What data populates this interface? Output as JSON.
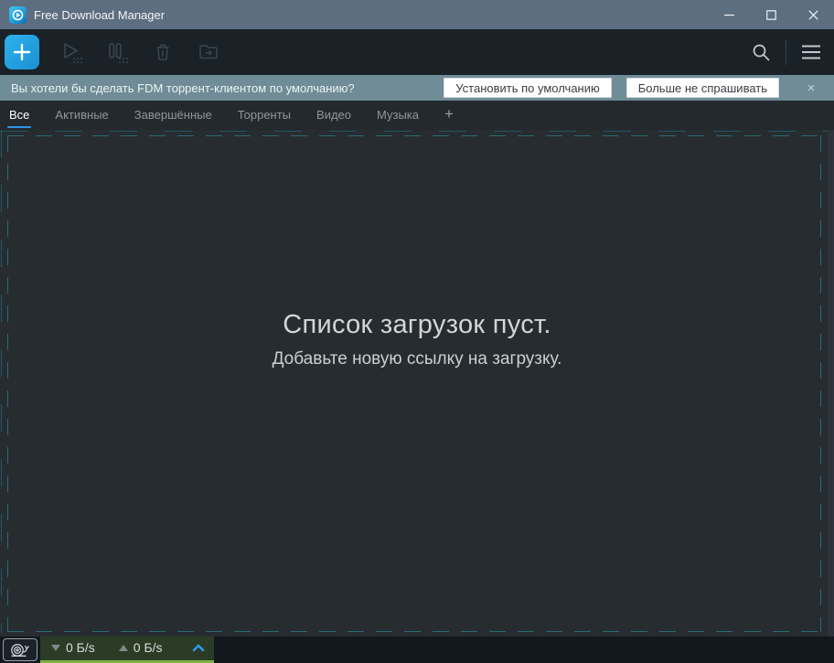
{
  "window": {
    "title": "Free Download Manager"
  },
  "toolbar": {
    "add_label": "+",
    "icons": [
      "add",
      "start-downloads",
      "pause-downloads",
      "delete-download",
      "open-folder",
      "search",
      "menu"
    ]
  },
  "notification": {
    "message": "Вы хотели бы сделать FDM торрент-клиентом по умолчанию?",
    "primary_button": "Установить по умолчанию",
    "secondary_button": "Больше не спрашивать",
    "close": "×"
  },
  "tabs": [
    {
      "label": "Все",
      "active": true
    },
    {
      "label": "Активные",
      "active": false
    },
    {
      "label": "Завершённые",
      "active": false
    },
    {
      "label": "Торренты",
      "active": false
    },
    {
      "label": "Видео",
      "active": false
    },
    {
      "label": "Музыка",
      "active": false
    }
  ],
  "tab_add_label": "+",
  "empty_state": {
    "title": "Список загрузок пуст.",
    "subtitle": "Добавьте новую ссылку на загрузку."
  },
  "statusbar": {
    "download_speed": "0 Б/s",
    "upload_speed": "0 Б/s"
  },
  "colors": {
    "titlebar": "#5d6e81",
    "toolbar": "#1a2127",
    "notification": "#6f8c97",
    "background": "#272c31",
    "accent_blue": "#2f95e5",
    "add_button_blue": "#1b8fd4",
    "dash_teal": "#2a6a76",
    "speed_green": "#7cb342",
    "speed_panel_bg": "#2c3b26"
  }
}
